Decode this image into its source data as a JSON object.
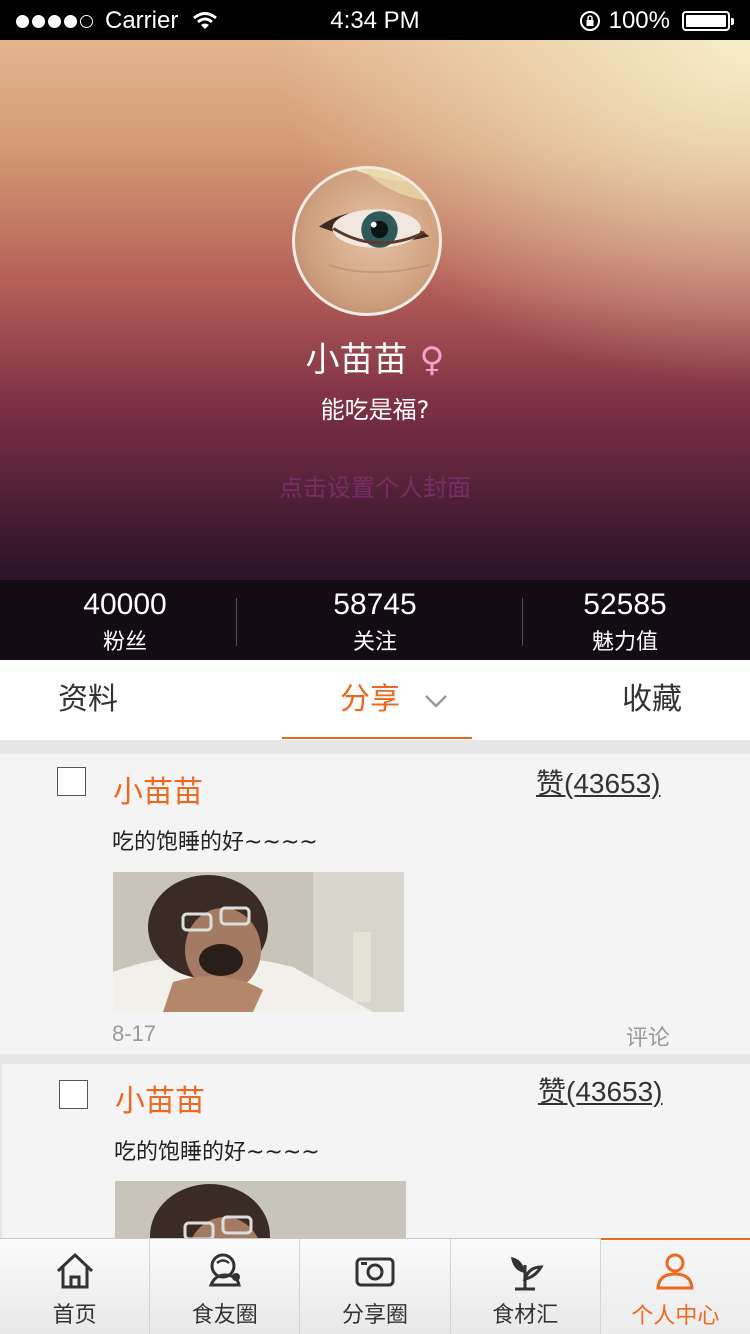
{
  "status_bar": {
    "carrier": "Carrier",
    "time": "4:34 PM",
    "battery": "100%",
    "icons": [
      "signal-dots-icon",
      "wifi-icon",
      "rotation-lock-icon",
      "battery-icon"
    ]
  },
  "profile": {
    "username": "小苗苗",
    "gender_symbol": "♀",
    "signature": "能吃是福?",
    "cover_link": "点击设置个人封面",
    "colors": {
      "accent": "#ee6820",
      "gender": "#f4a3c8",
      "cover_link": "#7a2c64"
    }
  },
  "stats": [
    {
      "value": "40000",
      "label": "粉丝"
    },
    {
      "value": "58745",
      "label": "关注"
    },
    {
      "value": "52585",
      "label": "魅力值"
    }
  ],
  "tabs": [
    {
      "label": "资料"
    },
    {
      "label": "分享",
      "active": true
    },
    {
      "label": "收藏"
    }
  ],
  "posts": [
    {
      "author": "小苗苗",
      "likes": "赞(43653)",
      "text": "吃的饱睡的好~~~~",
      "date": "8-17",
      "comment": "评论"
    },
    {
      "author": "小苗苗",
      "likes": "赞(43653)",
      "text": "吃的饱睡的好~~~~"
    }
  ],
  "tabbar": [
    {
      "label": "首页",
      "icon": "home-icon"
    },
    {
      "label": "食友圈",
      "icon": "food-friends-icon"
    },
    {
      "label": "分享圈",
      "icon": "camera-icon"
    },
    {
      "label": "食材汇",
      "icon": "sprout-icon"
    },
    {
      "label": "个人中心",
      "icon": "person-icon",
      "active": true
    }
  ]
}
